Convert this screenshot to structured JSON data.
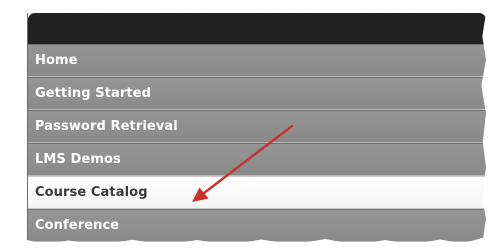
{
  "menu": {
    "items": [
      {
        "label": "Home",
        "selected": false
      },
      {
        "label": "Getting Started",
        "selected": false
      },
      {
        "label": "Password Retrieval",
        "selected": false
      },
      {
        "label": "LMS Demos",
        "selected": false
      },
      {
        "label": "Course Catalog",
        "selected": true
      },
      {
        "label": "Conference",
        "selected": false
      }
    ]
  },
  "colors": {
    "header": "#222222",
    "item_background": "#8f8f8f",
    "item_text": "#ffffff",
    "selected_background": "#ffffff",
    "selected_text": "#3a3a3a",
    "arrow": "#c8322c"
  },
  "annotation": {
    "type": "red-arrow",
    "points_to": "Course Catalog"
  }
}
